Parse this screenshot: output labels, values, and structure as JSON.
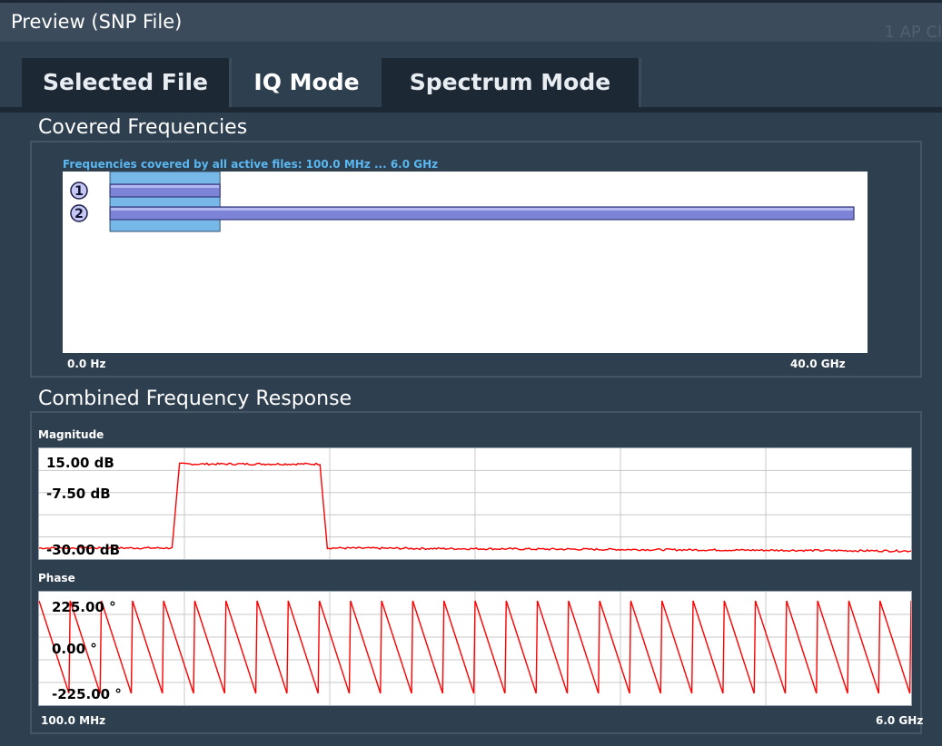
{
  "window": {
    "title": "Preview (SNP File)",
    "ghost_text": "1 AP Cl"
  },
  "tabs": [
    {
      "label": "Selected File",
      "active": false
    },
    {
      "label": "IQ Mode",
      "active": true
    },
    {
      "label": "Spectrum Mode",
      "active": false
    }
  ],
  "covered": {
    "title": "Covered Frequencies",
    "caption": "Frequencies covered by all active files: 100.0 MHz ... 6.0 GHz",
    "axis_start": "0.0 Hz",
    "axis_end": "40.0 GHz",
    "files": [
      {
        "index": "1",
        "start_ghz": 0.1,
        "stop_ghz": 6.0
      },
      {
        "index": "2",
        "start_ghz": 0.1,
        "stop_ghz": 40.0
      }
    ],
    "colors": {
      "file_bar": "#7d84d8",
      "common_range": "#78b8e8"
    }
  },
  "response": {
    "title": "Combined Frequency Response",
    "magnitude": {
      "label": "Magnitude",
      "ticks": [
        "15.00 dB",
        "-7.50 dB",
        "-30.00 dB"
      ]
    },
    "phase": {
      "label": "Phase",
      "ticks": [
        "225.00 °",
        "0.00 °",
        "-225.00 °"
      ]
    },
    "x_start": "100.0 MHz",
    "x_end": "6.0 GHz",
    "trace_color": "#ff0000"
  },
  "chart_data": [
    {
      "type": "line",
      "title": "Magnitude",
      "x_unit": "GHz",
      "ylim": [
        -30,
        15
      ],
      "series": [
        {
          "x": [
            0.1,
            1.0,
            1.05,
            2.0,
            2.05,
            6.0
          ],
          "y": [
            -29,
            -29,
            13.5,
            13.5,
            -29,
            -30.5
          ]
        }
      ]
    },
    {
      "type": "line",
      "title": "Phase",
      "x_unit": "GHz",
      "ylim": [
        -225,
        225
      ],
      "sawtooth_cycles": 28,
      "range": [
        -225,
        225
      ]
    }
  ]
}
